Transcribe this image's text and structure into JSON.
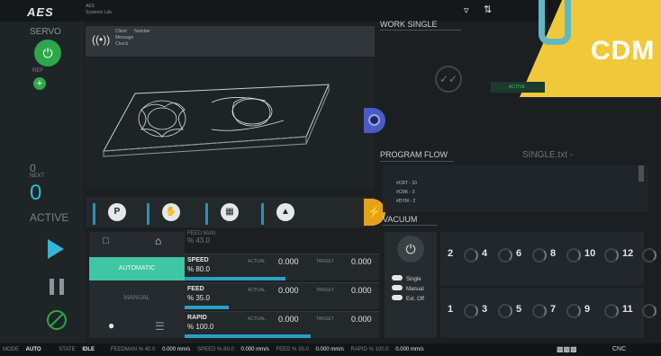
{
  "header": {
    "brand": "AES",
    "subtitle1": "AES",
    "subtitle2": "Systems Lab",
    "work_title": "WORK SINGLE",
    "watermark": "CDM",
    "active_tag": "ACTIVE"
  },
  "message_panel": {
    "client_label": "Client",
    "number_label": "Number",
    "message_label": "Message",
    "check_label": "Check"
  },
  "servo": {
    "title": "SERVO",
    "ref_label": "REF",
    "next_label": "NEXT",
    "next_value": "0",
    "count_value": "0",
    "active_label": "ACTIVE"
  },
  "program_flow": {
    "title": "PROGRAM FLOW",
    "file": "SINGLE.txt -",
    "lines": [
      "#CRT - 10",
      "#CRK - 3",
      "#DYM - 2"
    ]
  },
  "vacuum": {
    "title": "VACUUM",
    "modes": [
      "Single",
      "Manual",
      "Ext. Off"
    ],
    "top_zones": [
      "2",
      "4",
      "6",
      "8",
      "10",
      "12"
    ],
    "bottom_zones": [
      "1",
      "3",
      "5",
      "7",
      "9",
      "11"
    ]
  },
  "toolbar": {
    "tool_icons": [
      "p-icon",
      "hand-icon",
      "calculator-icon",
      "sweep-icon"
    ]
  },
  "mode_panel": {
    "automatic": "AUTOMATIC",
    "manual": "MANUAL",
    "feed_man_label": "FEED MAN",
    "feed_man_value": "% 43.0"
  },
  "params": [
    {
      "name": "SPEED",
      "pct": "% 80.0",
      "actual_label": "ACTUAL",
      "actual": "0.000",
      "target_label": "TARGET",
      "target": "0.000",
      "fill": 0.8
    },
    {
      "name": "FEED",
      "pct": "% 35.0",
      "actual_label": "ACTUAL",
      "actual": "0.000",
      "target_label": "TARGET",
      "target": "0.000",
      "fill": 0.35
    },
    {
      "name": "RAPID",
      "pct": "% 100.0",
      "actual_label": "ACTUAL",
      "actual": "0.000",
      "target_label": "TARGET",
      "target": "0.000",
      "fill": 1.0
    }
  ],
  "statusbar": {
    "mode_label": "MODE",
    "mode_value": "AUTO",
    "state_label": "STATE",
    "state_value": "IDLE",
    "feedman": "FEEDMAN % 40.0",
    "feedman_val": "0.000 mm/s",
    "speed": "SPEED % 80.0",
    "speed_val": "0.000 mm/s",
    "feed": "FEED % 35.0",
    "feed_val": "0.000 mm/s",
    "rapid": "RAPID % 100.0",
    "rapid_val": "0.000 mm/s",
    "right_label": "CNC"
  }
}
